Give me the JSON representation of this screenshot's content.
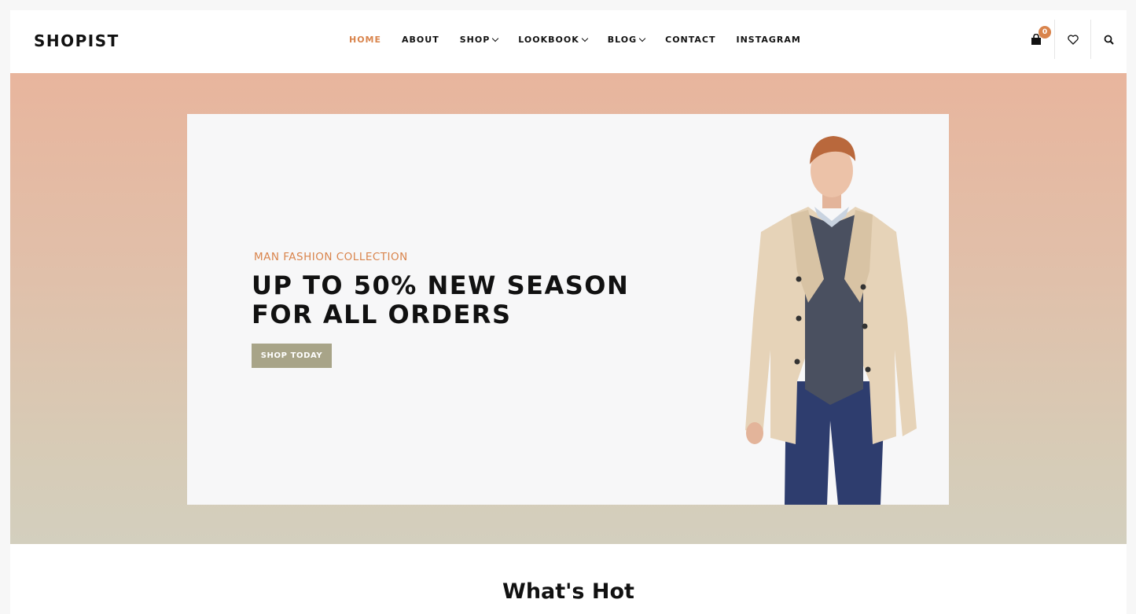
{
  "brand": {
    "logo": "SHOPIST",
    "accent_color": "#d9844c",
    "button_color": "#a8a488"
  },
  "nav": {
    "home": "HOME",
    "about": "ABOUT",
    "shop": "SHOP",
    "lookbook": "LOOKBOOK",
    "blog": "BLOG",
    "contact": "CONTACT",
    "instagram": "INSTAGRAM"
  },
  "header_icons": {
    "cart_icon": "shopping-bag-icon",
    "cart_count": "0",
    "wishlist_icon": "heart-icon",
    "search_icon": "search-icon"
  },
  "hero": {
    "eyebrow": "MAN FASHION COLLECTION",
    "headline_line1": "UP TO 50% NEW SEASON",
    "headline_line2": "FOR ALL ORDERS",
    "cta": "SHOP TODAY"
  },
  "section": {
    "title": "What's Hot"
  }
}
